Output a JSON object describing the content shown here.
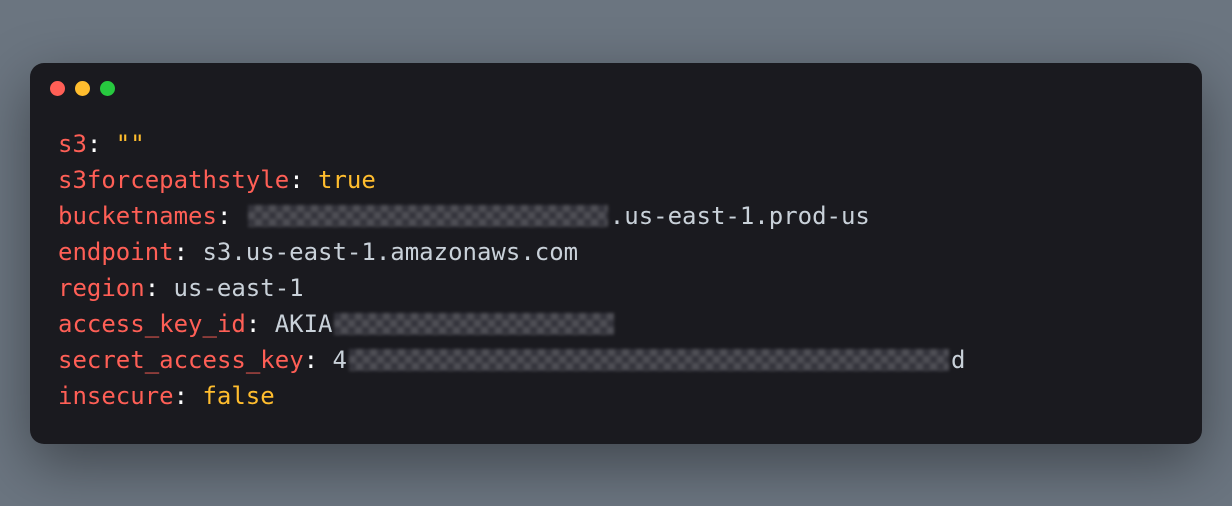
{
  "config": {
    "lines": [
      {
        "key": "s3",
        "value": "\"\"",
        "valueClass": "val-string",
        "prefix": "",
        "suffix": "",
        "redactedWidth": 0
      },
      {
        "key": "s3forcepathstyle",
        "value": "true",
        "valueClass": "val-bool",
        "prefix": "",
        "suffix": "",
        "redactedWidth": 0
      },
      {
        "key": "bucketnames",
        "value": "",
        "valueClass": "val-plain",
        "prefix": "",
        "suffix": ".us-east-1.prod-us",
        "redactedWidth": 360
      },
      {
        "key": "endpoint",
        "value": "s3.us-east-1.amazonaws.com",
        "valueClass": "val-plain",
        "prefix": "",
        "suffix": "",
        "redactedWidth": 0
      },
      {
        "key": "region",
        "value": "us-east-1",
        "valueClass": "val-plain",
        "prefix": "",
        "suffix": "",
        "redactedWidth": 0
      },
      {
        "key": "access_key_id",
        "value": "",
        "valueClass": "val-plain",
        "prefix": "AKIA",
        "suffix": "",
        "redactedWidth": 280
      },
      {
        "key": "secret_access_key",
        "value": "",
        "valueClass": "val-plain",
        "prefix": "4",
        "suffix": "d",
        "redactedWidth": 600
      },
      {
        "key": "insecure",
        "value": "false",
        "valueClass": "val-bool",
        "prefix": "",
        "suffix": "",
        "redactedWidth": 0
      }
    ]
  }
}
